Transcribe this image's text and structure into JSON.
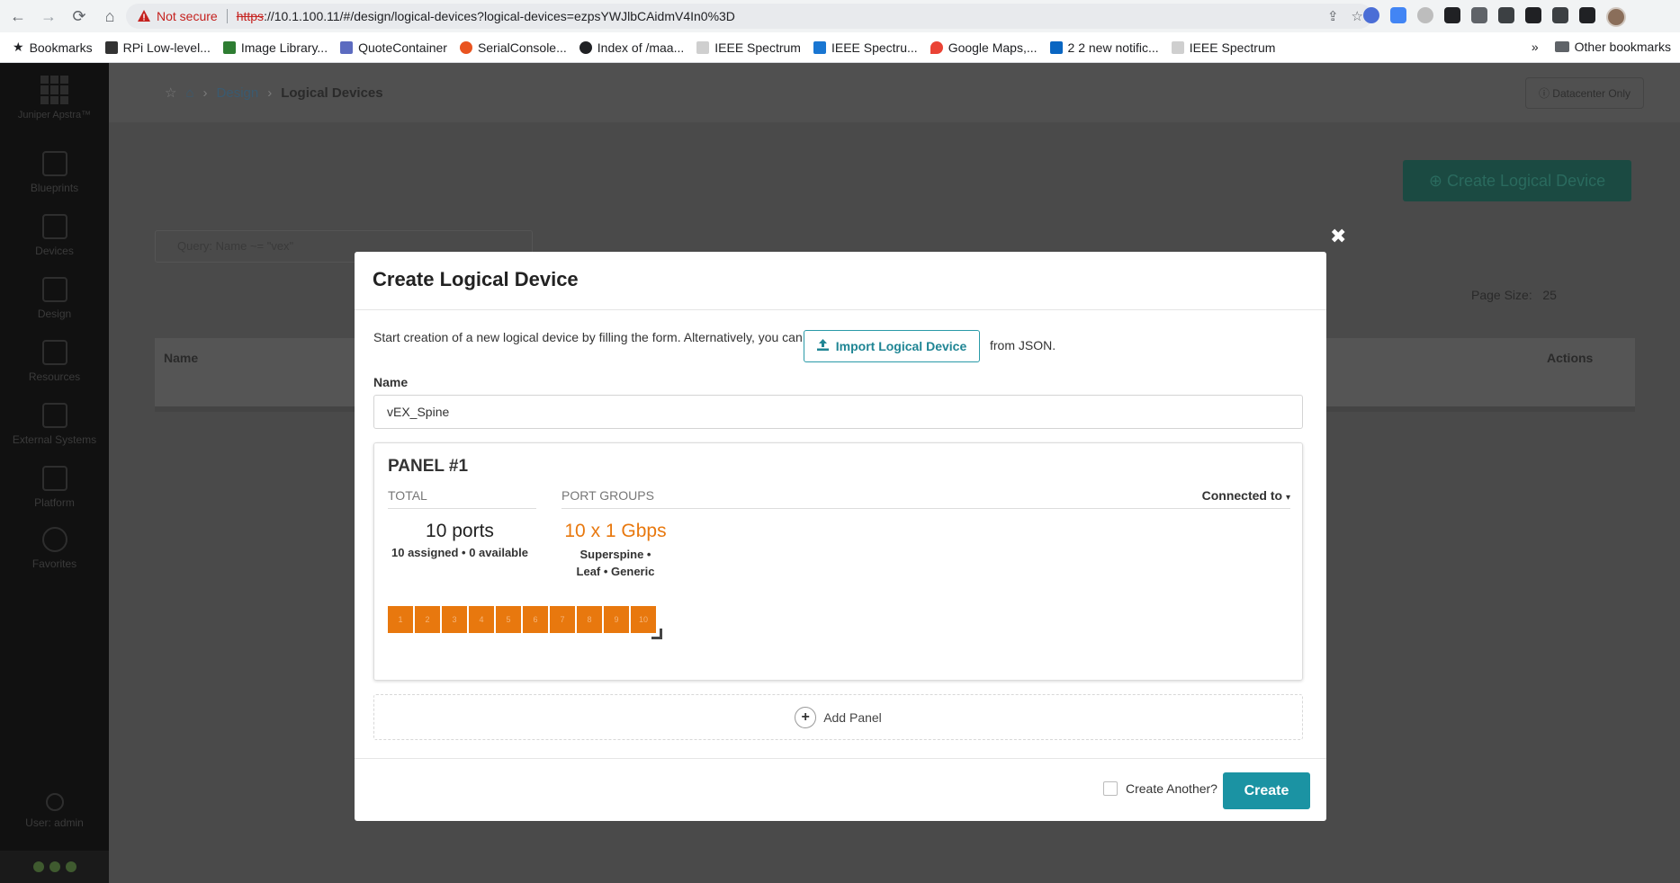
{
  "browser": {
    "security_label": "Not secure",
    "url_scheme": "https",
    "url_rest": "://10.1.100.11/#/design/logical-devices?logical-devices=ezpsYWJlbCAidmV4In0%3D",
    "bookmarks": [
      {
        "label": "Bookmarks",
        "color": "#202124"
      },
      {
        "label": "RPi Low-level...",
        "color": "#333333"
      },
      {
        "label": "Image Library...",
        "color": "#2e7d32"
      },
      {
        "label": "QuoteContainer",
        "color": "#5c6bc0"
      },
      {
        "label": "SerialConsole...",
        "color": "#e95420"
      },
      {
        "label": "Index of /maa...",
        "color": "#202124"
      },
      {
        "label": "IEEE Spectrum",
        "color": "#9e9e9e"
      },
      {
        "label": "IEEE Spectru...",
        "color": "#1976d2"
      },
      {
        "label": "Google Maps,...",
        "color": "#ea4335"
      },
      {
        "label": "2 2 new notific...",
        "color": "#0a66c2"
      },
      {
        "label": "IEEE Spectrum",
        "color": "#9e9e9e"
      }
    ],
    "overflow": "»",
    "other_bookmarks": "Other bookmarks"
  },
  "sidebar": {
    "brand": "Juniper Apstra™",
    "items": [
      {
        "label": "Blueprints"
      },
      {
        "label": "Devices"
      },
      {
        "label": "Design"
      },
      {
        "label": "Resources"
      },
      {
        "label": "External Systems"
      },
      {
        "label": "Platform"
      },
      {
        "label": "Favorites"
      }
    ],
    "user": "User: admin"
  },
  "header": {
    "breadcrumb": [
      "Design",
      "Logical Devices"
    ],
    "datacenter_only": "Datacenter Only"
  },
  "background": {
    "create_button": "Create Logical Device",
    "query": "Query: Name ~= \"vex\"",
    "page_size_label": "Page Size:",
    "page_size_value": "25",
    "col_name": "Name",
    "col_actions": "Actions"
  },
  "modal": {
    "title": "Create Logical Device",
    "intro": "Start creation of a new logical device by filling the form. Alternatively, you can",
    "import_button": "Import Logical Device",
    "from_json": "from JSON.",
    "name_label": "Name",
    "name_value": "vEX_Spine",
    "panel": {
      "title": "PANEL #1",
      "total_header": "TOTAL",
      "port_groups_header": "PORT GROUPS",
      "connected_to": "Connected to",
      "total_value": "10 ports",
      "total_sub": "10 assigned • 0 available",
      "group_value": "10 x 1 Gbps",
      "group_sub": "Superspine • Leaf • Generic",
      "ports": [
        "1",
        "2",
        "3",
        "4",
        "5",
        "6",
        "7",
        "8",
        "9",
        "10"
      ],
      "port_color": "#e8780e"
    },
    "add_panel": "Add Panel",
    "create_another": "Create Another?",
    "create_button": "Create",
    "accent_color": "#1b93a3"
  }
}
